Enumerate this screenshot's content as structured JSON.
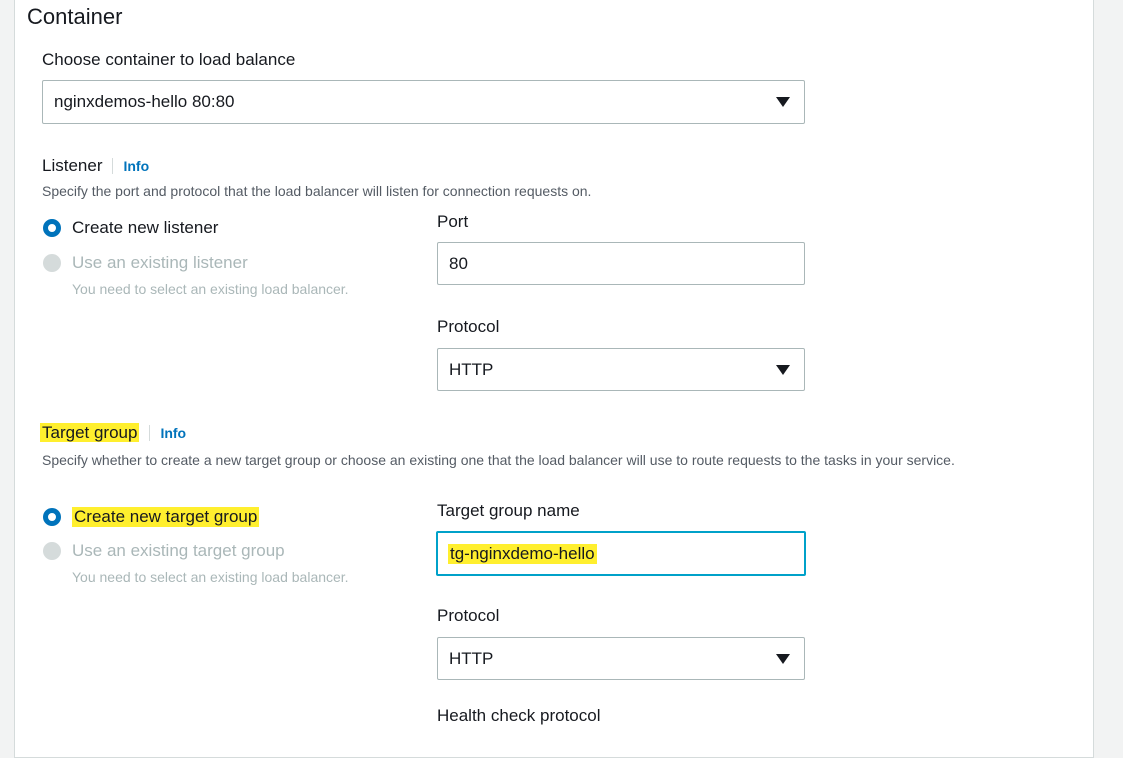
{
  "container": {
    "heading": "Container",
    "choose_label": "Choose container to load balance",
    "choose_value": "nginxdemos-hello 80:80"
  },
  "listener": {
    "label": "Listener",
    "info": "Info",
    "description": "Specify the port and protocol that the load balancer will listen for connection requests on.",
    "option_new": "Create new listener",
    "option_existing": "Use an existing listener",
    "option_existing_hint": "You need to select an existing load balancer.",
    "port_label": "Port",
    "port_value": "80",
    "protocol_label": "Protocol",
    "protocol_value": "HTTP"
  },
  "target_group": {
    "label": "Target group",
    "info": "Info",
    "description": "Specify whether to create a new target group or choose an existing one that the load balancer will use to route requests to the tasks in your service.",
    "option_new": "Create new target group",
    "option_existing": "Use an existing target group",
    "option_existing_hint": "You need to select an existing load balancer.",
    "name_label": "Target group name",
    "name_value": "tg-nginxdemo-hello",
    "protocol_label": "Protocol",
    "protocol_value": "HTTP",
    "health_check_label": "Health check protocol"
  },
  "colors": {
    "accent": "#0073bb",
    "highlight": "#ffef2e",
    "focus": "#00a1c9"
  }
}
